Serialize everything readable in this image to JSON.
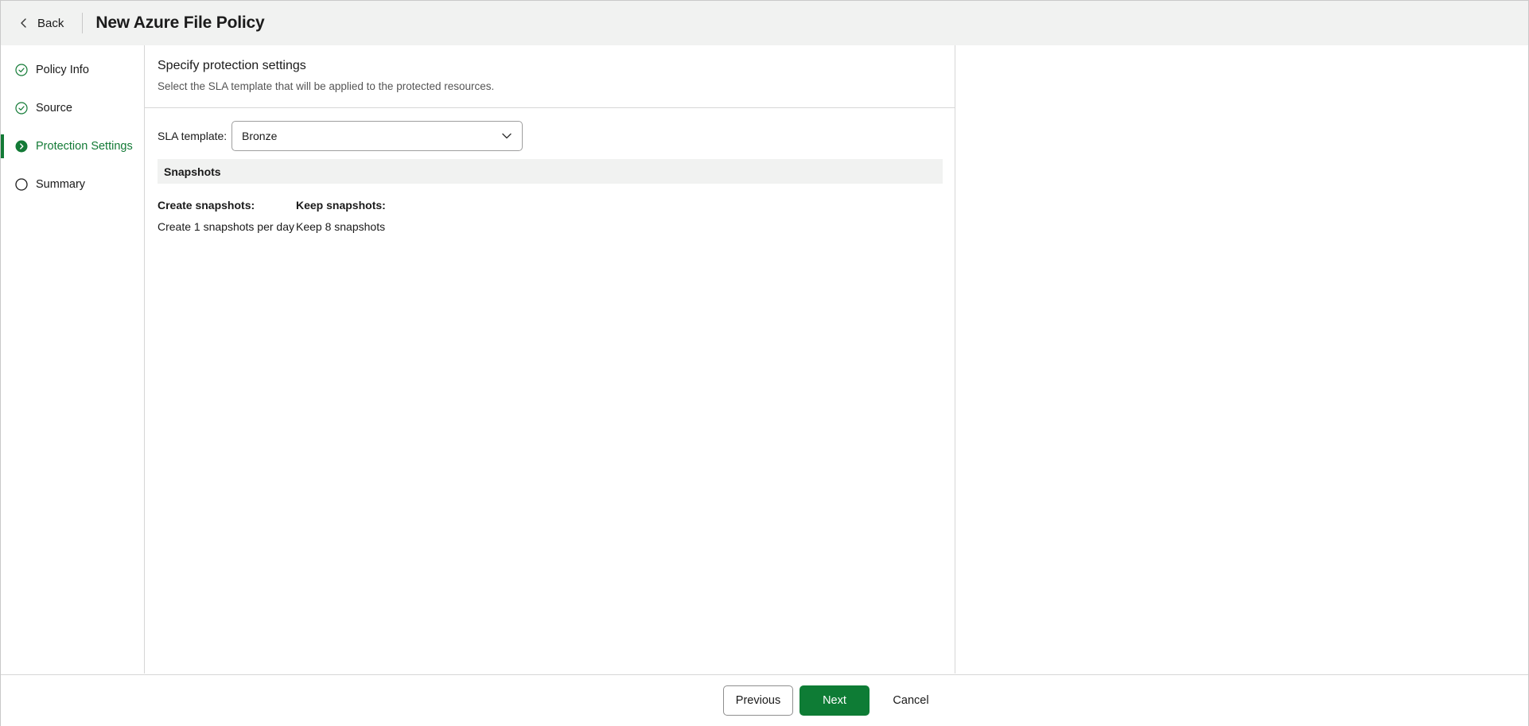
{
  "header": {
    "back_label": "Back",
    "title": "New Azure File Policy"
  },
  "sidebar": {
    "steps": [
      {
        "label": "Policy Info",
        "state": "completed"
      },
      {
        "label": "Source",
        "state": "completed"
      },
      {
        "label": "Protection Settings",
        "state": "current"
      },
      {
        "label": "Summary",
        "state": "pending"
      }
    ]
  },
  "main": {
    "title": "Specify protection settings",
    "subtitle": "Select the SLA template that will be applied to the protected resources.",
    "sla_label": "SLA template:",
    "sla_value": "Bronze",
    "snapshots_header": "Snapshots",
    "create_title": "Create snapshots:",
    "create_value": "Create 1 snapshots per day",
    "keep_title": "Keep snapshots:",
    "keep_value": "Keep 8 snapshots"
  },
  "footer": {
    "previous_label": "Previous",
    "next_label": "Next",
    "cancel_label": "Cancel"
  },
  "colors": {
    "accent": "#137a36",
    "primary_button": "#0e7c35",
    "header_bg": "#f1f2f1"
  },
  "icons": {
    "back": "chevron-left-icon",
    "completed": "check-circle-icon",
    "current": "chevron-right-circle-icon",
    "pending": "empty-circle-icon",
    "dropdown": "chevron-down-icon"
  }
}
